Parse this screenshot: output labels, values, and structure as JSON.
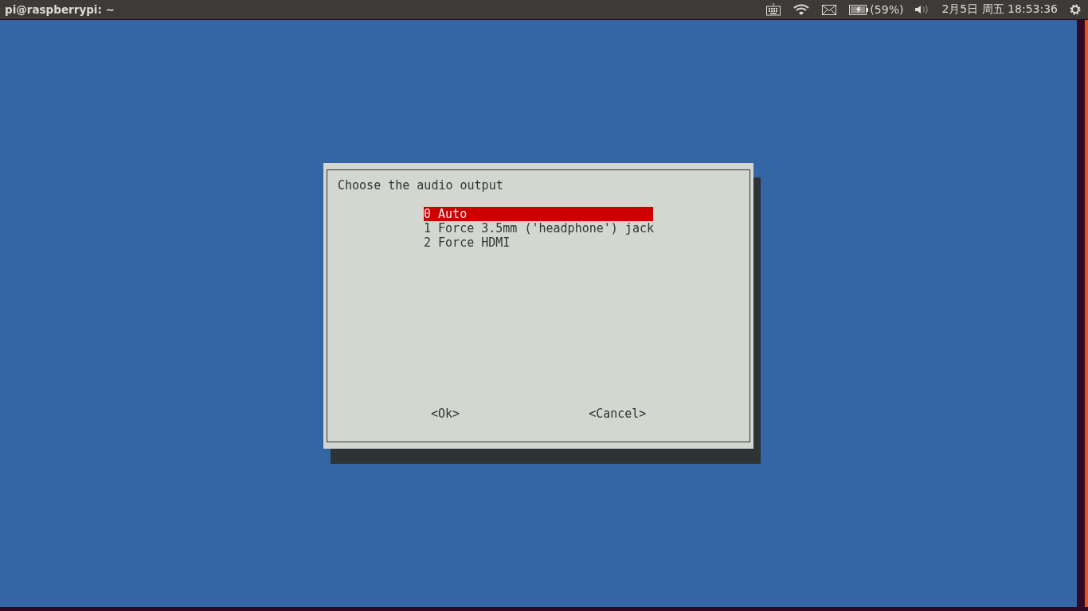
{
  "top_bar": {
    "title": "pi@raspberrypi: ~",
    "battery": "(59%)",
    "clock": "2月5日 周五 18:53:36"
  },
  "dialog": {
    "prompt": "Choose the audio output",
    "items": [
      {
        "label": "0 Auto",
        "selected": true
      },
      {
        "label": "1 Force 3.5mm ('headphone') jack",
        "selected": false
      },
      {
        "label": "2 Force HDMI",
        "selected": false
      }
    ],
    "buttons": [
      "<Ok>",
      "<Cancel>"
    ]
  }
}
